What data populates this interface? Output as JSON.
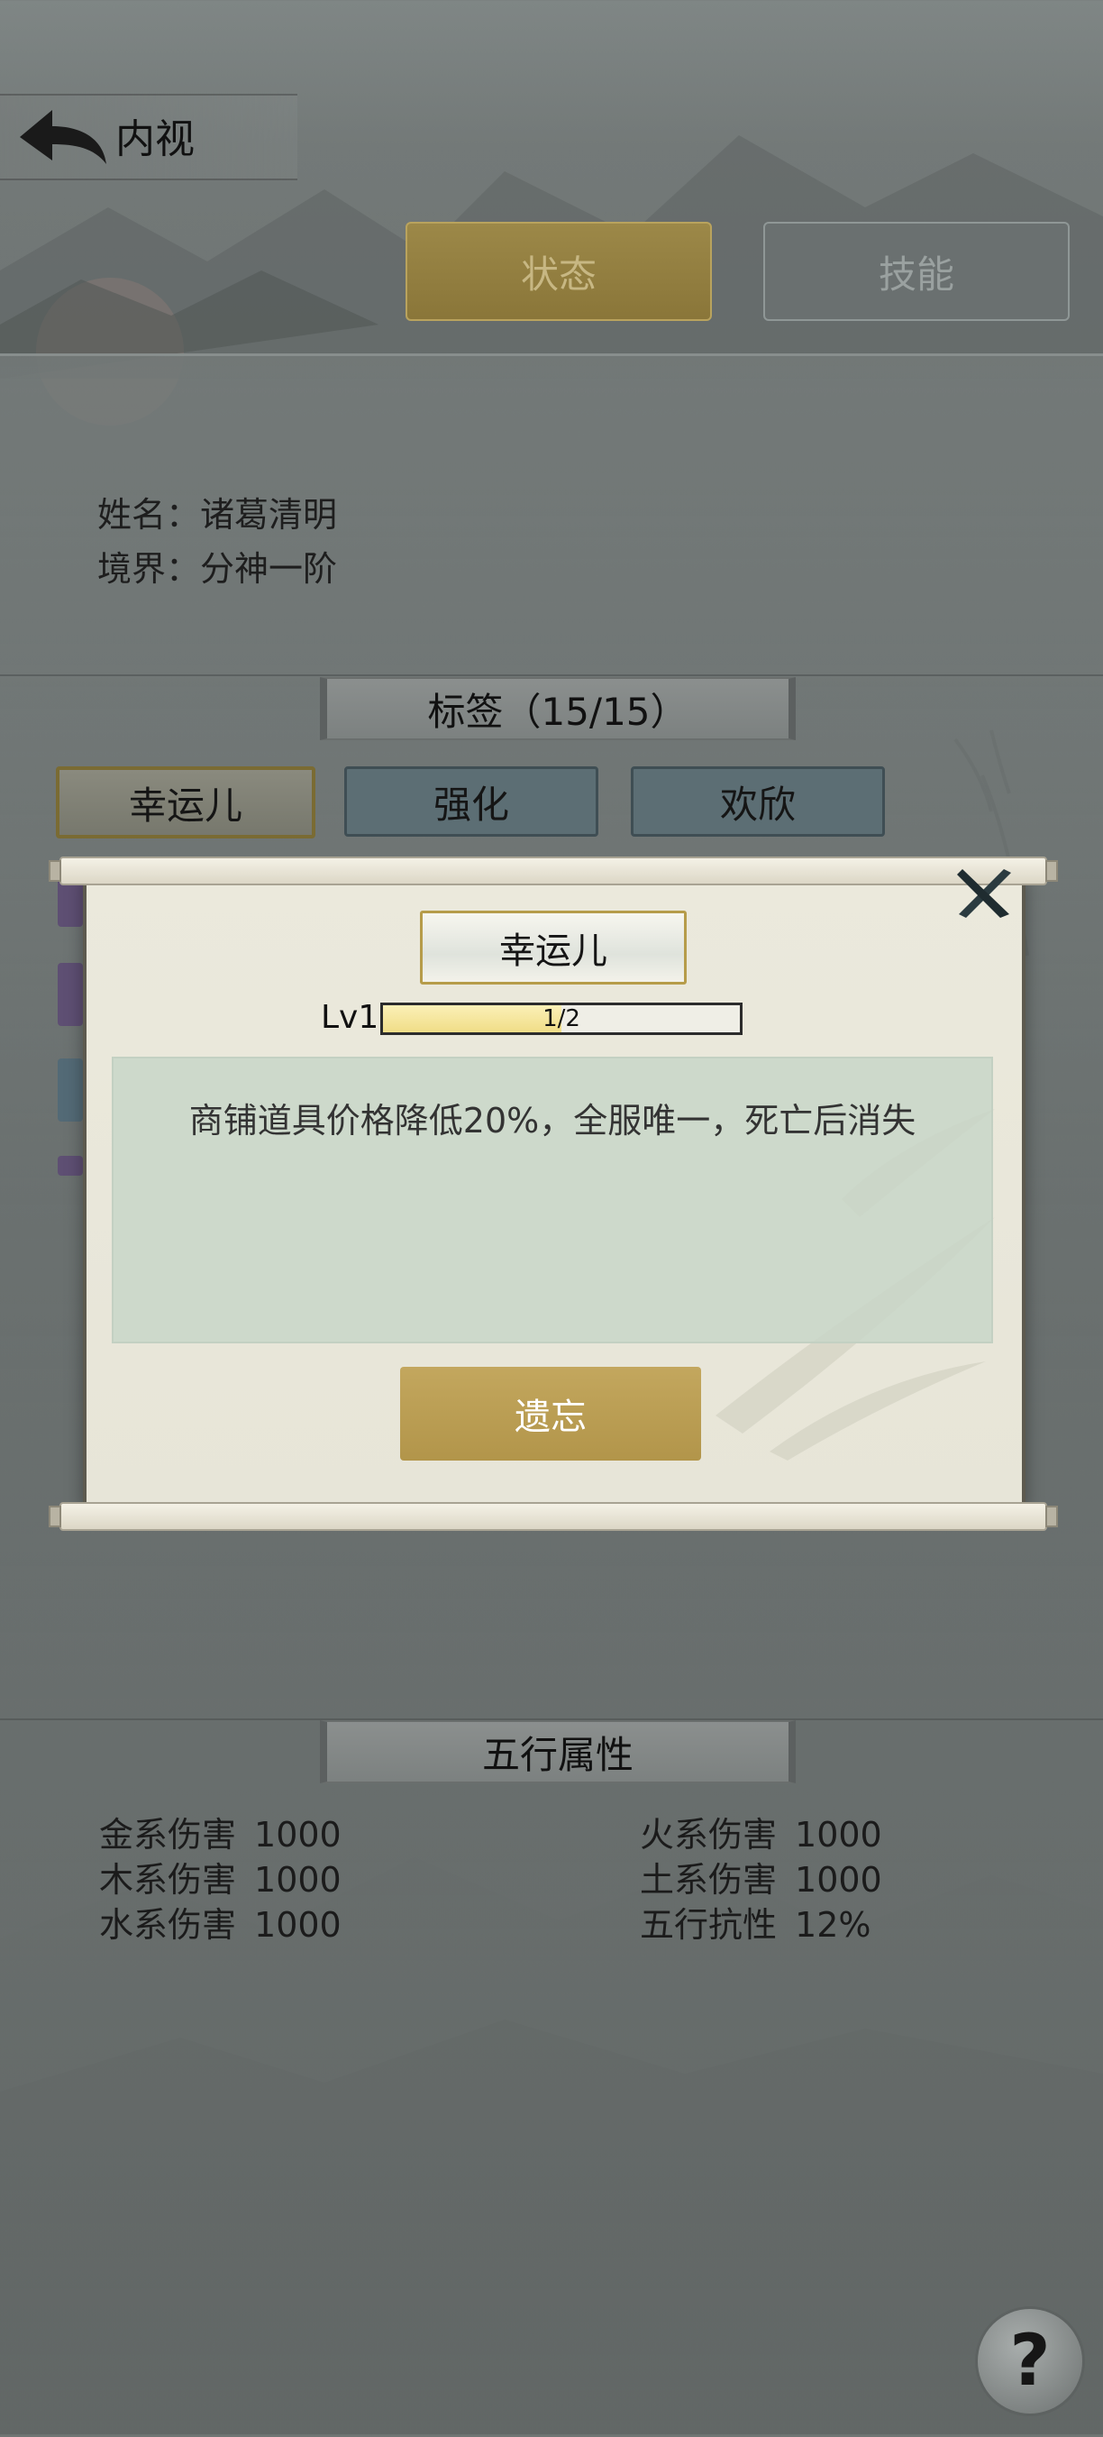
{
  "header": {
    "title": "内视"
  },
  "tabs": [
    {
      "label": "状态",
      "active": true
    },
    {
      "label": "技能",
      "active": false
    }
  ],
  "profile": {
    "name_label": "姓名：诸葛清明",
    "realm_label": "境界：分神一阶"
  },
  "tags_section": {
    "title": "标签（15/15）",
    "items": [
      "幸运儿",
      "强化",
      "欢欣"
    ]
  },
  "dialog": {
    "title": "幸运儿",
    "level_label": "Lv1",
    "progress_text": "1/2",
    "progress_fraction": 0.5,
    "description": "商铺道具价格降低20%，全服唯一，死亡后消失",
    "forget_label": "遗忘"
  },
  "elements_section": {
    "title": "五行属性",
    "left": [
      {
        "label": "金系伤害",
        "value": "1000"
      },
      {
        "label": "木系伤害",
        "value": "1000"
      },
      {
        "label": "水系伤害",
        "value": "1000"
      }
    ],
    "right": [
      {
        "label": "火系伤害",
        "value": "1000"
      },
      {
        "label": "土系伤害",
        "value": "1000"
      },
      {
        "label": "五行抗性",
        "value": "12%"
      }
    ]
  },
  "help": {
    "label": "?"
  },
  "colors": {
    "accent_gold": "#b2954a",
    "dialog_paper": "#ebe9dc",
    "desc_panel": "#c8d6c8"
  }
}
